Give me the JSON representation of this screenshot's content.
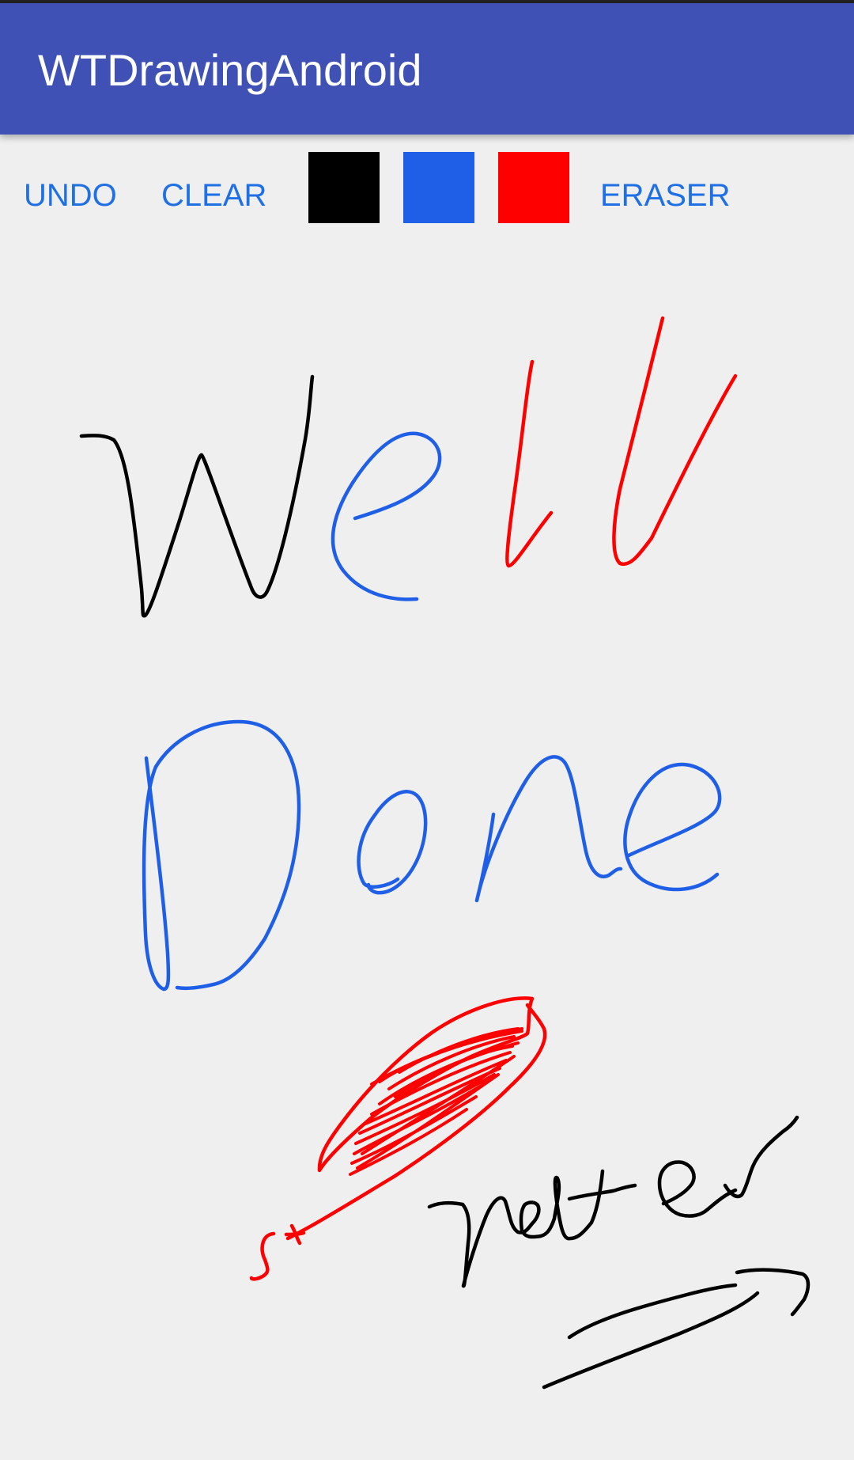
{
  "app": {
    "title": "WTDrawingAndroid"
  },
  "toolbar": {
    "undo_label": "UNDO",
    "clear_label": "CLEAR",
    "eraser_label": "ERASER",
    "swatches": [
      {
        "name": "black",
        "color": "#000000"
      },
      {
        "name": "blue",
        "color": "#1f5fe8"
      },
      {
        "name": "red",
        "color": "#ff0000"
      }
    ]
  },
  "colors": {
    "app_bar": "#3f51b5",
    "button_text": "#1f6fe5",
    "canvas_background": "#efefef",
    "ink_black": "#000000",
    "ink_blue": "#1f5fe8",
    "ink_red": "#ff0000"
  },
  "canvas": {
    "stroke_count": 16
  }
}
